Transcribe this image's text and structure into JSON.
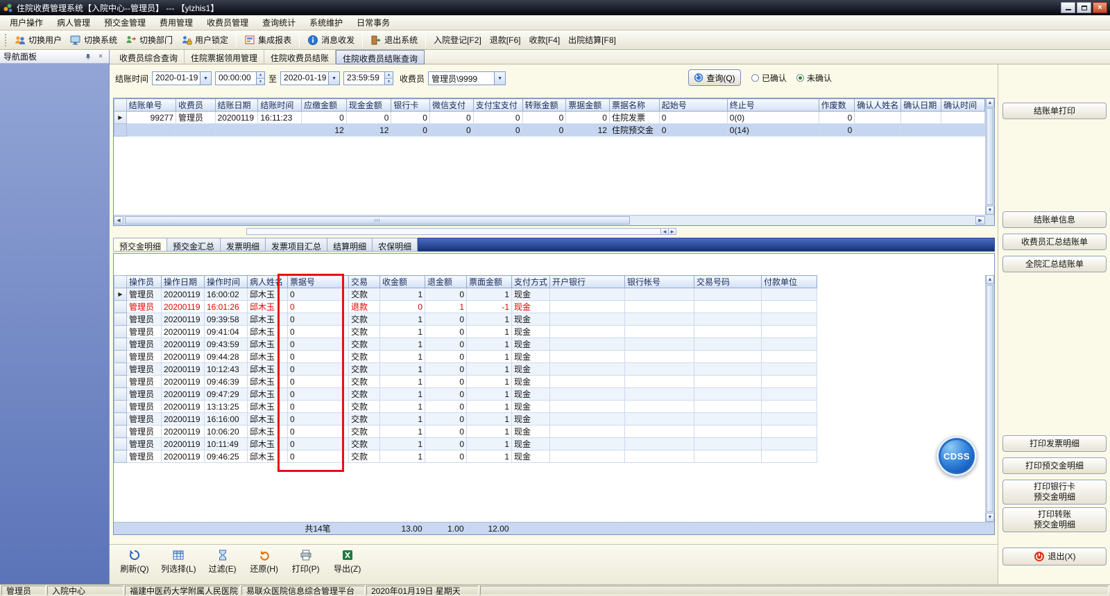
{
  "window": {
    "title": "住院收费管理系统【入院中心--管理员】 --- 【ylzhis1】"
  },
  "menubar": {
    "items": [
      "用户操作",
      "病人管理",
      "预交金管理",
      "费用管理",
      "收费员管理",
      "查询统计",
      "系统维护",
      "日常事务"
    ]
  },
  "toolbar": {
    "items": [
      {
        "label": "切换用户"
      },
      {
        "label": "切换系统"
      },
      {
        "label": "切换部门"
      },
      {
        "label": "用户锁定"
      },
      {
        "label": "集成报表"
      },
      {
        "label": "消息收发"
      },
      {
        "label": "退出系统"
      },
      {
        "label": "入院登记[F2]"
      },
      {
        "label": "退款[F6]"
      },
      {
        "label": "收款[F4]"
      },
      {
        "label": "出院结算[F8]"
      }
    ]
  },
  "nav_panel": {
    "title": "导航面板"
  },
  "tabs": {
    "items": [
      "收费员综合查询",
      "住院票据领用管理",
      "住院收费员结账",
      "住院收费员结账查询"
    ],
    "active": "住院收费员结账查询"
  },
  "filter": {
    "settle_time_label": "结账时间",
    "date_from": "2020-01-19",
    "time_from": "00:00:00",
    "to_label": "至",
    "date_to": "2020-01-19",
    "time_to": "23:59:59",
    "cashier_label": "收费员",
    "cashier_value": "管理员\\9999",
    "query_button": "查询(Q)",
    "radio_options": [
      {
        "label": "已确认",
        "selected": false
      },
      {
        "label": "未确认",
        "selected": true
      }
    ]
  },
  "top_grid": {
    "columns": [
      "结账单号",
      "收费员",
      "结账日期",
      "结账时间",
      "应缴金额",
      "现金金额",
      "银行卡",
      "微信支付",
      "支付宝支付",
      "转账金额",
      "票据金额",
      "票据名称",
      "起始号",
      "终止号",
      "作废数",
      "确认人姓名",
      "确认日期",
      "确认时间"
    ],
    "rows": [
      [
        "99277",
        "管理员",
        "20200119",
        "16:11:23",
        "0",
        "0",
        "0",
        "0",
        "0",
        "0",
        "0",
        "住院发票",
        "0",
        "0(0)",
        "0",
        "",
        "",
        ""
      ],
      [
        "",
        "",
        "",
        "",
        "12",
        "12",
        "0",
        "0",
        "0",
        "0",
        "12",
        "住院预交金",
        "0",
        "0(14)",
        "0",
        "",
        "",
        ""
      ]
    ],
    "current_row": 0
  },
  "sub_tabs": {
    "items": [
      "预交金明细",
      "预交金汇总",
      "发票明细",
      "发票项目汇总",
      "结算明细",
      "农保明细"
    ],
    "active": "预交金明细"
  },
  "bottom_grid": {
    "columns": [
      "操作员",
      "操作日期",
      "操作时间",
      "病人姓名",
      "票据号",
      "交易",
      "收金额",
      "退金额",
      "票面金额",
      "支付方式",
      "开户银行",
      "银行帐号",
      "交易号码",
      "付款单位"
    ],
    "rows": [
      [
        "管理员",
        "20200119",
        "16:00:02",
        "邱木玉",
        "0",
        "交款",
        "1",
        "0",
        "1",
        "现金",
        "",
        "",
        "",
        ""
      ],
      [
        "管理员",
        "20200119",
        "16:01:26",
        "邱木玉",
        "0",
        "退款",
        "0",
        "1",
        "-1",
        "现金",
        "",
        "",
        "",
        ""
      ],
      [
        "管理员",
        "20200119",
        "09:39:58",
        "邱木玉",
        "0",
        "交款",
        "1",
        "0",
        "1",
        "现金",
        "",
        "",
        "",
        ""
      ],
      [
        "管理员",
        "20200119",
        "09:41:04",
        "邱木玉",
        "0",
        "交款",
        "1",
        "0",
        "1",
        "现金",
        "",
        "",
        "",
        ""
      ],
      [
        "管理员",
        "20200119",
        "09:43:59",
        "邱木玉",
        "0",
        "交款",
        "1",
        "0",
        "1",
        "现金",
        "",
        "",
        "",
        ""
      ],
      [
        "管理员",
        "20200119",
        "09:44:28",
        "邱木玉",
        "0",
        "交款",
        "1",
        "0",
        "1",
        "现金",
        "",
        "",
        "",
        ""
      ],
      [
        "管理员",
        "20200119",
        "10:12:43",
        "邱木玉",
        "0",
        "交款",
        "1",
        "0",
        "1",
        "现金",
        "",
        "",
        "",
        ""
      ],
      [
        "管理员",
        "20200119",
        "09:46:39",
        "邱木玉",
        "0",
        "交款",
        "1",
        "0",
        "1",
        "现金",
        "",
        "",
        "",
        ""
      ],
      [
        "管理员",
        "20200119",
        "09:47:29",
        "邱木玉",
        "0",
        "交款",
        "1",
        "0",
        "1",
        "现金",
        "",
        "",
        "",
        ""
      ],
      [
        "管理员",
        "20200119",
        "13:13:25",
        "邱木玉",
        "0",
        "交款",
        "1",
        "0",
        "1",
        "现金",
        "",
        "",
        "",
        ""
      ],
      [
        "管理员",
        "20200119",
        "16:16:00",
        "邱木玉",
        "0",
        "交款",
        "1",
        "0",
        "1",
        "现金",
        "",
        "",
        "",
        ""
      ],
      [
        "管理员",
        "20200119",
        "10:06:20",
        "邱木玉",
        "0",
        "交款",
        "1",
        "0",
        "1",
        "现金",
        "",
        "",
        "",
        ""
      ],
      [
        "管理员",
        "20200119",
        "10:11:49",
        "邱木玉",
        "0",
        "交款",
        "1",
        "0",
        "1",
        "现金",
        "",
        "",
        "",
        ""
      ],
      [
        "管理员",
        "20200119",
        "09:46:25",
        "邱木玉",
        "0",
        "交款",
        "1",
        "0",
        "1",
        "现金",
        "",
        "",
        "",
        ""
      ]
    ],
    "red_rows": [
      1
    ],
    "current_row": 0
  },
  "summary": {
    "count": "共14笔",
    "amt_received": "13.00",
    "amt_refunded": "1.00",
    "amt_face": "12.00"
  },
  "bottom_toolbar": {
    "items": [
      "刷新(Q)",
      "列选择(L)",
      "过滤(E)",
      "还原(H)",
      "打印(P)",
      "导出(Z)"
    ]
  },
  "right_panel": {
    "buttons": [
      "结账单打印",
      "结账单信息",
      "收费员汇总结账单",
      "全院汇总结账单",
      "打印发票明细",
      "打印预交金明细",
      "打印银行卡\n预交金明细",
      "打印转账\n预交金明细",
      "退出(X)"
    ],
    "logo_text": "CDSS"
  },
  "statusbar": {
    "items": [
      "管理员",
      "入院中心",
      "福建中医药大学附属人民医院",
      "易联众医院信息综合管理平台",
      "2020年01月19日 星期天"
    ]
  }
}
